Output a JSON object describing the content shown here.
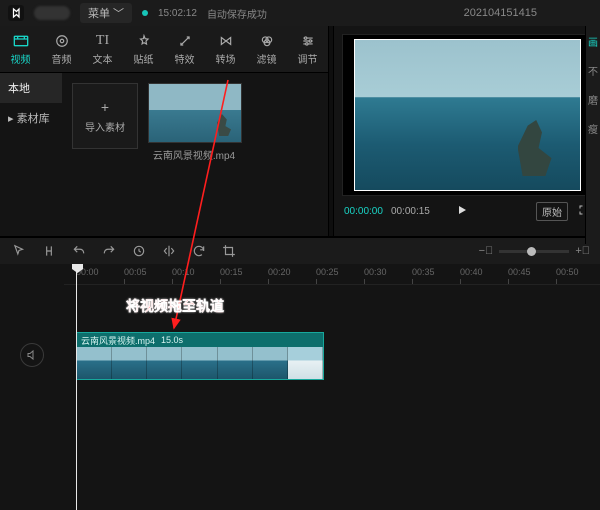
{
  "titlebar": {
    "menu": "菜单",
    "autosave_time": "15:02:12",
    "autosave_text": "自动保存成功",
    "project": "202104151415"
  },
  "tool_tabs": [
    {
      "id": "video",
      "label": "视频"
    },
    {
      "id": "audio",
      "label": "音频"
    },
    {
      "id": "text",
      "label": "文本"
    },
    {
      "id": "sticker",
      "label": "贴纸"
    },
    {
      "id": "effect",
      "label": "特效"
    },
    {
      "id": "transition",
      "label": "转场"
    },
    {
      "id": "filter",
      "label": "滤镜"
    },
    {
      "id": "adjust",
      "label": "调节"
    }
  ],
  "side_nav": {
    "local": "本地",
    "library": "素材库"
  },
  "media": {
    "import": "导入素材",
    "clip_name": "云南风景视频.mp4"
  },
  "preview": {
    "tc_current": "00:00:00",
    "tc_total": "00:00:15",
    "original": "原始"
  },
  "mini_right": {
    "a": "画",
    "b": "不",
    "c": "磨",
    "d": "瘦"
  },
  "ruler": [
    "00:00",
    "00:05",
    "00:10",
    "00:15",
    "00:20",
    "00:25",
    "00:30",
    "00:35",
    "00:40",
    "00:45",
    "00:50"
  ],
  "clip": {
    "name": "云南风景视频.mp4",
    "duration": "15.0s"
  },
  "annotation": "将视频拖至轨道"
}
